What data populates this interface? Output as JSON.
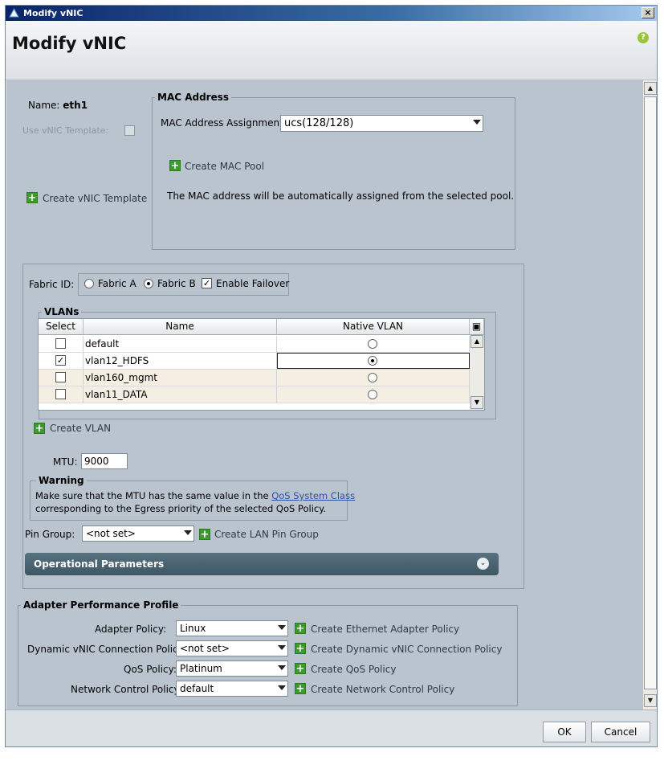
{
  "window": {
    "title": "Modify vNIC",
    "close_glyph": "×"
  },
  "header": {
    "title": "Modify vNIC",
    "help_glyph": "?"
  },
  "left": {
    "name_label": "Name:",
    "name_value": "eth1",
    "use_template_label": "Use vNIC Template:",
    "create_template_label": "Create vNIC Template"
  },
  "mac": {
    "legend": "MAC Address",
    "assignment_label": "MAC Address Assignment:",
    "assignment_value": "ucs(128/128)",
    "create_pool_label": "Create MAC Pool",
    "info_text": "The MAC address will be automatically assigned from the selected pool."
  },
  "fabric": {
    "label": "Fabric ID:",
    "option_a": "Fabric A",
    "option_b": "Fabric B",
    "selected": "Fabric B",
    "failover_label": "Enable Failover",
    "failover_checked": true
  },
  "vlans": {
    "legend": "VLANs",
    "columns": [
      "Select",
      "Name",
      "Native VLAN"
    ],
    "rows": [
      {
        "selected": false,
        "name": "default",
        "native": false
      },
      {
        "selected": true,
        "name": "vlan12_HDFS",
        "native": true
      },
      {
        "selected": false,
        "name": "vlan160_mgmt",
        "native": false
      },
      {
        "selected": false,
        "name": "vlan11_DATA",
        "native": false
      }
    ],
    "create_label": "Create VLAN"
  },
  "mtu": {
    "label": "MTU:",
    "value": "9000"
  },
  "warning": {
    "legend": "Warning",
    "text_before": "Make sure that the MTU has the same value in the ",
    "link_text": "QoS System Class",
    "text_after": "corresponding to the Egress priority of the selected QoS Policy."
  },
  "pin_group": {
    "label": "Pin Group:",
    "value": "<not set>",
    "create_label": "Create LAN Pin Group"
  },
  "operational": {
    "label": "Operational Parameters"
  },
  "adapter": {
    "legend": "Adapter Performance Profile",
    "rows": [
      {
        "label": "Adapter Policy:",
        "value": "Linux",
        "create_label": "Create Ethernet Adapter Policy"
      },
      {
        "label": "Dynamic vNIC Connection Policy:",
        "value": "<not set>",
        "create_label": "Create Dynamic vNIC Connection Policy"
      },
      {
        "label": "QoS Policy:",
        "value": "Platinum",
        "create_label": "Create QoS Policy"
      },
      {
        "label": "Network Control Policy:",
        "value": "default",
        "create_label": "Create Network Control Policy"
      }
    ]
  },
  "footer": {
    "ok_label": "OK",
    "cancel_label": "Cancel"
  },
  "colors": {
    "accent_green": "#3e9a2f",
    "panel_bg": "#b9c4ce",
    "ops_bar": "#4a6371"
  }
}
